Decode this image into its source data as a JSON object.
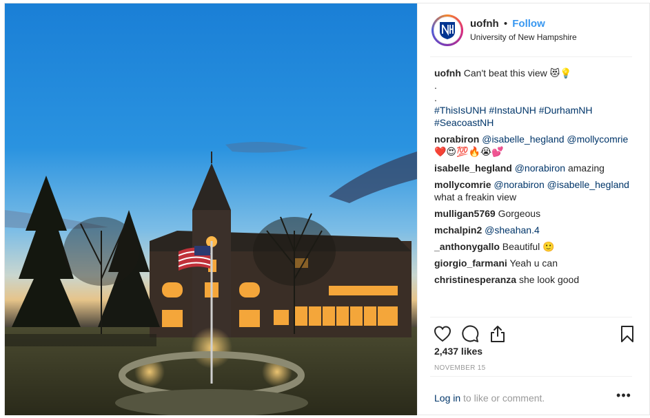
{
  "post": {
    "username": "uofnh",
    "separator": "•",
    "follow_label": "Follow",
    "location": "University of New Hampshire",
    "caption": {
      "user": "uofnh",
      "text": "Can't beat this view 😻💡",
      "dots": [
        ".",
        "."
      ],
      "hashtags_line1": "#ThisIsUNH #InstaUNH #DurhamNH",
      "hashtags_line2": "#SeacoastNH"
    },
    "comments": [
      {
        "user": "norabiron",
        "mentions": "@isabelle_hegland @mollycomrie",
        "text": "❤️😍💯🔥😭💕"
      },
      {
        "user": "isabelle_hegland",
        "mentions": "@norabiron",
        "text": "amazing"
      },
      {
        "user": "mollycomrie",
        "mentions": "@norabiron @isabelle_hegland",
        "text": "what a freakin view"
      },
      {
        "user": "mulligan5769",
        "mentions": "",
        "text": "Gorgeous"
      },
      {
        "user": "mchalpin2",
        "mentions": "@sheahan.4",
        "text": ""
      },
      {
        "user": "_anthonygallo",
        "mentions": "",
        "text": "Beautiful 🙂"
      },
      {
        "user": "giorgio_farmani",
        "mentions": "",
        "text": "Yeah u can"
      },
      {
        "user": "christinesperanza",
        "mentions": "",
        "text": "she look good"
      }
    ],
    "likes": "2,437 likes",
    "date": "NOVEMBER 15",
    "login_link": "Log in",
    "login_rest": " to like or comment.",
    "more_label": "•••"
  },
  "icons": {
    "avatar": "unh-logo-icon",
    "like": "heart-icon",
    "comment": "speech-bubble-icon",
    "share": "share-icon",
    "save": "bookmark-icon",
    "more": "more-options-icon"
  },
  "colors": {
    "follow": "#3897f0",
    "mention": "#003569",
    "muted": "#999999",
    "text": "#262626",
    "unh_blue": "#003591"
  }
}
